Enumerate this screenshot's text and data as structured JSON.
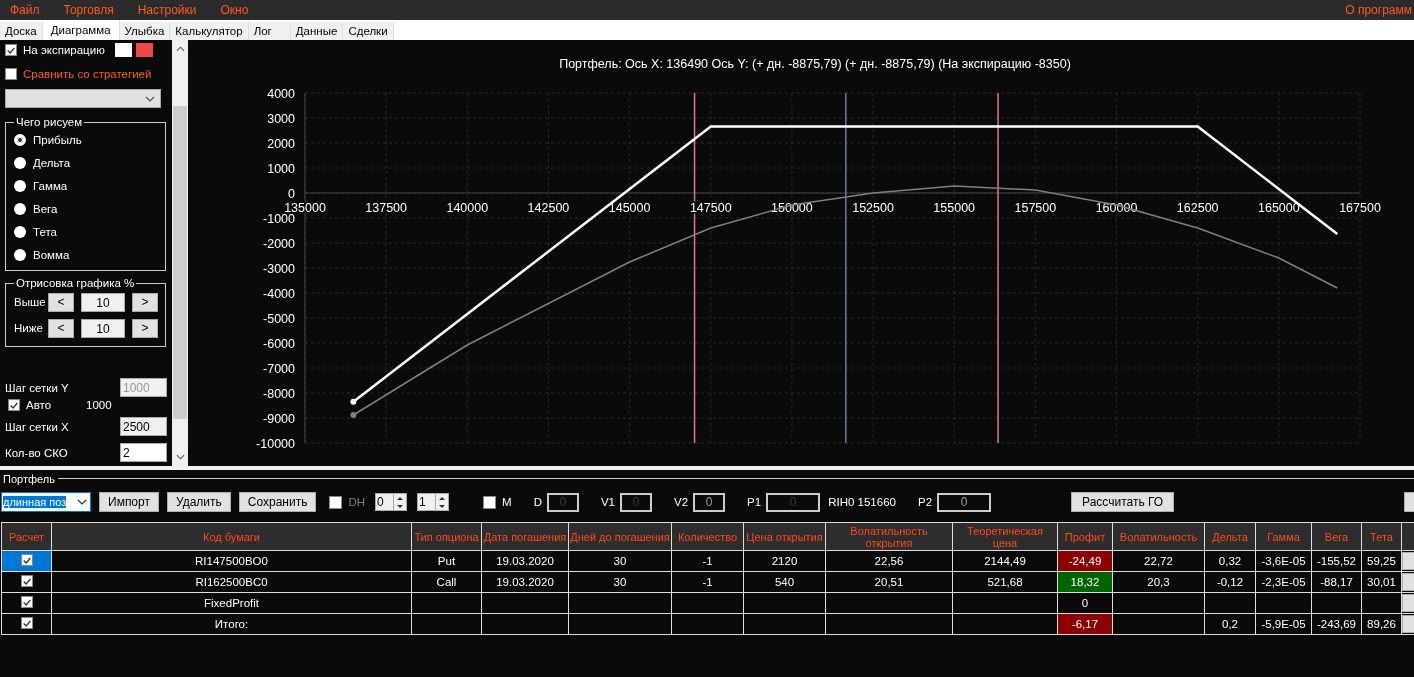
{
  "menu": {
    "items": [
      "Файл",
      "Торговля",
      "Настройки",
      "Окно"
    ],
    "about": "О программ"
  },
  "tabs": [
    {
      "label": "Доска",
      "selected": false
    },
    {
      "label": "Диаграмма",
      "selected": true
    },
    {
      "label": "Улыбка",
      "selected": false
    },
    {
      "label": "Калькулятор",
      "selected": false
    },
    {
      "label": "Лог",
      "selected": false
    },
    {
      "label": "Данные",
      "selected": false
    },
    {
      "label": "Сделки",
      "selected": false
    }
  ],
  "settings": {
    "expiry": {
      "label": "На экспирацию",
      "checked": true,
      "swatches": [
        {
          "color": "#ffffff"
        },
        {
          "color": "#f04848"
        }
      ]
    },
    "compare": {
      "label": "Сравнить со стратегией",
      "checked": false
    },
    "draw_group": {
      "title": "Чего рисуем",
      "options": [
        {
          "label": "Прибыль",
          "selected": true
        },
        {
          "label": "Дельта",
          "selected": false
        },
        {
          "label": "Гамма",
          "selected": false
        },
        {
          "label": "Вега",
          "selected": false
        },
        {
          "label": "Тета",
          "selected": false
        },
        {
          "label": "Вомма",
          "selected": false
        }
      ]
    },
    "range_group": {
      "title": "Отрисовка графика %",
      "rows": [
        {
          "label": "Выше",
          "dec": "<",
          "value": "10",
          "inc": ">"
        },
        {
          "label": "Ниже",
          "dec": "<",
          "value": "10",
          "inc": ">"
        }
      ]
    },
    "grid_y": {
      "label": "Шаг сетки Y",
      "value": "1000",
      "disabled": true
    },
    "auto": {
      "label": "Авто",
      "checked": true,
      "value": "1000"
    },
    "grid_x": {
      "label": "Шаг сетки X",
      "value": "2500",
      "disabled": false
    },
    "sko": {
      "label": "Кол-во СКО",
      "value": "2",
      "disabled": false
    }
  },
  "chart": {
    "title": "Портфель: Ось X: 136490 Ось Y: (+ дн. -8875,79) (+ дн. -8875,79) (На экспирацию -8350)",
    "chart_data": {
      "type": "line",
      "x": [
        136490,
        140000,
        145000,
        147500,
        150000,
        152500,
        155000,
        157500,
        160000,
        162500,
        165000,
        166800
      ],
      "series": [
        {
          "color": "#ffffff",
          "values": [
            -8350,
            -4840,
            160,
            2660,
            2660,
            2660,
            2660,
            2660,
            2660,
            2660,
            160,
            -1640
          ]
        },
        {
          "color": "#808080",
          "values": [
            -8880,
            -6080,
            -2760,
            -1400,
            -480,
            0,
            280,
            120,
            -480,
            -1400,
            -2600,
            -3800
          ]
        }
      ],
      "grid": true,
      "xlim": [
        135000,
        167500
      ],
      "ylim": [
        -10000,
        4000
      ],
      "xticks": [
        135000,
        137500,
        140000,
        142500,
        145000,
        147500,
        150000,
        152500,
        155000,
        157500,
        160000,
        162500,
        165000,
        167500
      ],
      "yticks": [
        -10000,
        -9000,
        -8000,
        -7000,
        -6000,
        -5000,
        -4000,
        -3000,
        -2000,
        -1000,
        0,
        1000,
        2000,
        3000,
        4000
      ],
      "ref_lines": [
        {
          "axis": "x",
          "value": 147000,
          "color": "#e07888"
        },
        {
          "axis": "x",
          "value": 151660,
          "color": "#6a8098"
        },
        {
          "axis": "x",
          "value": 156350,
          "color": "#e07888"
        }
      ]
    }
  },
  "portfolio": {
    "title": "Портфель",
    "strategy": "длинная поз",
    "buttons": [
      "Импорт",
      "Удалить",
      "Сохранить"
    ],
    "dh": {
      "label": "DH",
      "checked": false
    },
    "spinners": [
      "0",
      "1"
    ],
    "m": {
      "label": "M",
      "checked": false
    },
    "fields": [
      {
        "label": "D",
        "value": "0",
        "disabled": true
      },
      {
        "label": "V1",
        "value": "0",
        "disabled": true
      },
      {
        "label": "V2",
        "value": "0",
        "disabled": false
      },
      {
        "label": "P1",
        "value": "0",
        "disabled": true,
        "note": "RIH0 151660"
      },
      {
        "label": "P2",
        "value": "0",
        "disabled": false
      }
    ],
    "calc_button": "Рассчитать ГО",
    "columns": [
      "Расчет",
      "Код бумаги",
      "Тип опциона",
      "Дата погашения",
      "Дней до погашения",
      "Количество",
      "Цена открытия",
      "Волатильность открытия",
      "Теоретическая цена",
      "Профит",
      "Волатильность",
      "Дельта",
      "Гамма",
      "Вега",
      "Тета"
    ],
    "rows": [
      {
        "selected": true,
        "checked": true,
        "code": "RI147500BO0",
        "type": "Put",
        "date": "19.03.2020",
        "days": "30",
        "qty": "-1",
        "price": "2120",
        "open_vol": "22,56",
        "theo": "2144,49",
        "profit": {
          "value": "-24,49",
          "color": "#8b0000"
        },
        "vol": "22,72",
        "delta": "0,32",
        "gamma": "-3,6E-05",
        "vega": "-155,52",
        "theta": "59,25"
      },
      {
        "selected": false,
        "checked": true,
        "code": "RI162500BC0",
        "type": "Call",
        "date": "19.03.2020",
        "days": "30",
        "qty": "-1",
        "price": "540",
        "open_vol": "20,51",
        "theo": "521,68",
        "profit": {
          "value": "18,32",
          "color": "#006400"
        },
        "vol": "20,3",
        "delta": "-0,12",
        "gamma": "-2,3E-05",
        "vega": "-88,17",
        "theta": "30,01"
      },
      {
        "selected": false,
        "checked": true,
        "code": "FixedProfit",
        "profit": {
          "value": "0"
        }
      },
      {
        "selected": false,
        "checked": true,
        "code": "Итого:",
        "profit": {
          "value": "-6,17",
          "color": "#8b0000"
        },
        "delta": "0,2",
        "gamma": "-5,9E-05",
        "vega": "-243,69",
        "theta": "89,26"
      }
    ]
  }
}
